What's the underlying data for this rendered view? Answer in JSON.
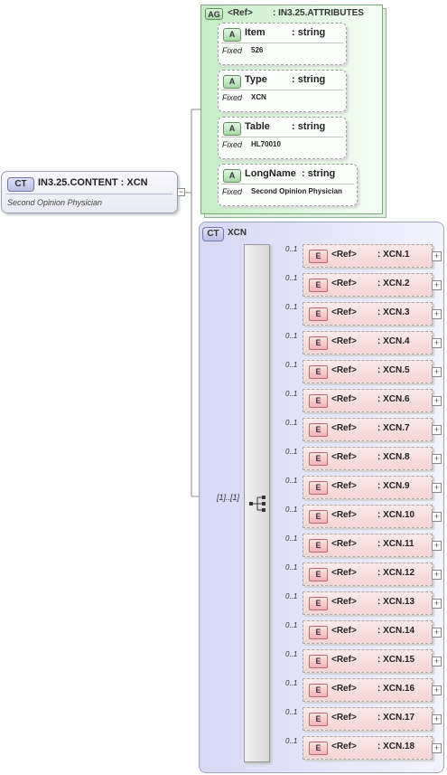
{
  "root": {
    "badge": "CT",
    "title": "IN3.25.CONTENT : XCN",
    "doc": "Second Opinion Physician",
    "collapse": "−"
  },
  "attribute_group": {
    "badge": "AG",
    "ref": "<Ref>",
    "name": ": IN3.25.ATTRIBUTES",
    "attributes": [
      {
        "badge": "A",
        "name": "Item",
        "type": ": string",
        "fixed_label": "Fixed",
        "fixed_value": "526"
      },
      {
        "badge": "A",
        "name": "Type",
        "type": ": string",
        "fixed_label": "Fixed",
        "fixed_value": "XCN"
      },
      {
        "badge": "A",
        "name": "Table",
        "type": ": string",
        "fixed_label": "Fixed",
        "fixed_value": "HL70010"
      },
      {
        "badge": "A",
        "name": "LongName",
        "type": ": string",
        "fixed_label": "Fixed",
        "fixed_value": "Second Opinion Physician"
      }
    ]
  },
  "complex_type": {
    "badge": "CT",
    "name": "XCN",
    "cardinality": "[1]..[1]",
    "elements": [
      {
        "badge": "E",
        "ref": "<Ref>",
        "name": ": XCN.1",
        "occurrence": "0..1"
      },
      {
        "badge": "E",
        "ref": "<Ref>",
        "name": ": XCN.2",
        "occurrence": "0..1"
      },
      {
        "badge": "E",
        "ref": "<Ref>",
        "name": ": XCN.3",
        "occurrence": "0..1"
      },
      {
        "badge": "E",
        "ref": "<Ref>",
        "name": ": XCN.4",
        "occurrence": "0..1"
      },
      {
        "badge": "E",
        "ref": "<Ref>",
        "name": ": XCN.5",
        "occurrence": "0..1"
      },
      {
        "badge": "E",
        "ref": "<Ref>",
        "name": ": XCN.6",
        "occurrence": "0..1"
      },
      {
        "badge": "E",
        "ref": "<Ref>",
        "name": ": XCN.7",
        "occurrence": "0..1"
      },
      {
        "badge": "E",
        "ref": "<Ref>",
        "name": ": XCN.8",
        "occurrence": "0..1"
      },
      {
        "badge": "E",
        "ref": "<Ref>",
        "name": ": XCN.9",
        "occurrence": "0..1"
      },
      {
        "badge": "E",
        "ref": "<Ref>",
        "name": ": XCN.10",
        "occurrence": "0..1"
      },
      {
        "badge": "E",
        "ref": "<Ref>",
        "name": ": XCN.11",
        "occurrence": "0..1"
      },
      {
        "badge": "E",
        "ref": "<Ref>",
        "name": ": XCN.12",
        "occurrence": "0..1"
      },
      {
        "badge": "E",
        "ref": "<Ref>",
        "name": ": XCN.13",
        "occurrence": "0..1"
      },
      {
        "badge": "E",
        "ref": "<Ref>",
        "name": ": XCN.14",
        "occurrence": "0..1"
      },
      {
        "badge": "E",
        "ref": "<Ref>",
        "name": ": XCN.15",
        "occurrence": "0..1"
      },
      {
        "badge": "E",
        "ref": "<Ref>",
        "name": ": XCN.16",
        "occurrence": "0..1"
      },
      {
        "badge": "E",
        "ref": "<Ref>",
        "name": ": XCN.17",
        "occurrence": "0..1"
      },
      {
        "badge": "E",
        "ref": "<Ref>",
        "name": ": XCN.18",
        "occurrence": "0..1"
      }
    ],
    "expand_symbol": "+"
  }
}
